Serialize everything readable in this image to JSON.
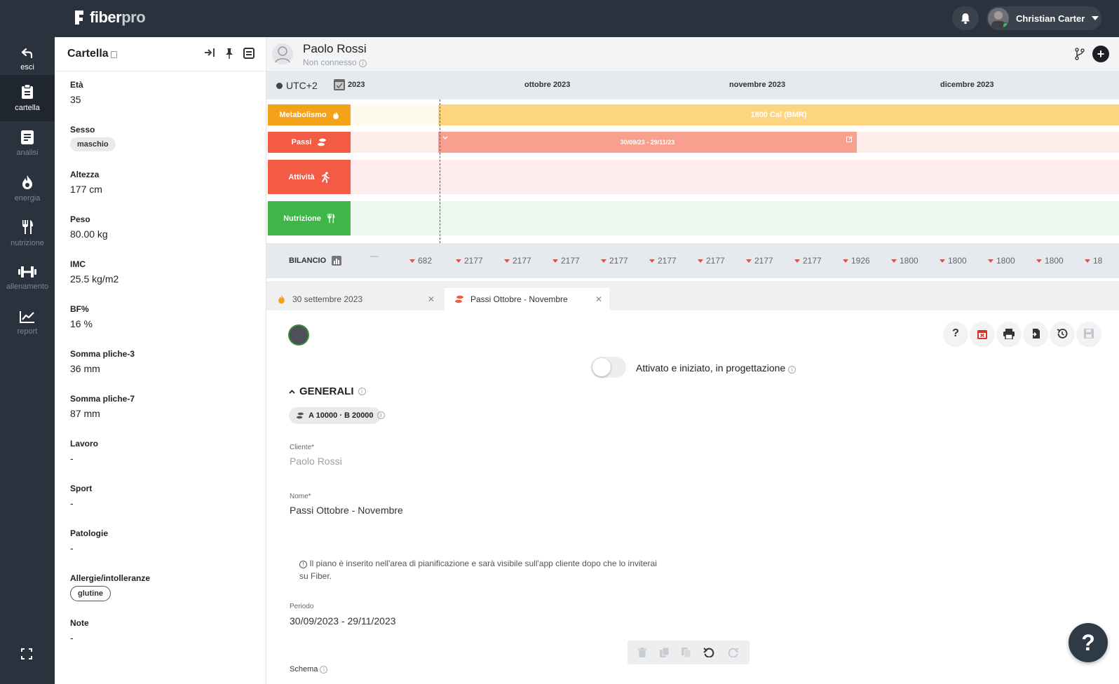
{
  "app": {
    "logo_main": "fiber",
    "logo_accent": "pro",
    "user_name": "Christian Carter"
  },
  "nav": {
    "items": [
      {
        "label": "esci",
        "icon": "back-arrow-icon"
      },
      {
        "label": "cartella",
        "icon": "clipboard-icon"
      },
      {
        "label": "analisi",
        "icon": "document-icon"
      },
      {
        "label": "energia",
        "icon": "flame-icon"
      },
      {
        "label": "nutrizione",
        "icon": "cutlery-icon"
      },
      {
        "label": "allenamento",
        "icon": "dumbbell-icon"
      },
      {
        "label": "report",
        "icon": "chart-line-icon"
      }
    ],
    "active": "cartella"
  },
  "cartella": {
    "title": "Cartella",
    "fields": [
      {
        "label": "Età",
        "value": "35"
      },
      {
        "label": "Sesso",
        "value": "maschio"
      },
      {
        "label": "Altezza",
        "value": "177 cm"
      },
      {
        "label": "Peso",
        "value": "80.00 kg"
      },
      {
        "label": "IMC",
        "value": "25.5 kg/m2"
      },
      {
        "label": "BF%",
        "value": "16 %"
      },
      {
        "label": "Somma pliche-3",
        "value": "36 mm"
      },
      {
        "label": "Somma pliche-7",
        "value": "87 mm"
      },
      {
        "label": "Lavoro",
        "value": "-"
      },
      {
        "label": "Sport",
        "value": "-"
      },
      {
        "label": "Patologie",
        "value": "-"
      },
      {
        "label": "Allergie/intolleranze",
        "value": "glutine"
      },
      {
        "label": "Note",
        "value": "-"
      }
    ]
  },
  "patient": {
    "name": "Paolo Rossi",
    "status": "Non connesso"
  },
  "timeline": {
    "timezone": "UTC+2",
    "months": [
      "2023",
      "ottobre 2023",
      "novembre 2023",
      "dicembre 2023"
    ],
    "rows": [
      {
        "label": "Metabolismo",
        "color": "#f5a21b",
        "bar_text": "1800 Cal (BMR)"
      },
      {
        "label": "Passi",
        "color": "#f45b45",
        "bar_text": "30/09/23 - 29/11/23"
      },
      {
        "label": "Attività",
        "color": "#f45b45"
      },
      {
        "label": "Nutrizione",
        "color": "#3fb748"
      }
    ],
    "bilancio_label": "BILANCIO",
    "bilancio_values": [
      "682",
      "2177",
      "2177",
      "2177",
      "2177",
      "2177",
      "2177",
      "2177",
      "2177",
      "1926",
      "1800",
      "1800",
      "1800",
      "1800",
      "18"
    ]
  },
  "tabs": [
    {
      "label": "30 settembre 2023",
      "icon": "flame-icon"
    },
    {
      "label": "Passi Ottobre - Novembre",
      "icon": "footsteps-icon"
    }
  ],
  "form": {
    "toggle_label": "Attivato e iniziato, in progettazione",
    "section": "GENERALI",
    "target": "A 10000 · B 20000",
    "cliente_label": "Cliente*",
    "cliente_value": "Paolo Rossi",
    "nome_label": "Nome*",
    "nome_value": "Passi Ottobre - Novembre",
    "notice": "Il piano è inserito nell'area di pianificazione e sarà visibile sull'app cliente dopo che lo inviterai su Fiber.",
    "periodo_label": "Periodo",
    "periodo_value": "30/09/2023 - 29/11/2023",
    "schema_label": "Schema"
  },
  "colors": {
    "sidebar": "#2a323d",
    "metabolismo": "#f5a21b",
    "passi": "#f45b45",
    "nutrizione": "#3fb748"
  }
}
